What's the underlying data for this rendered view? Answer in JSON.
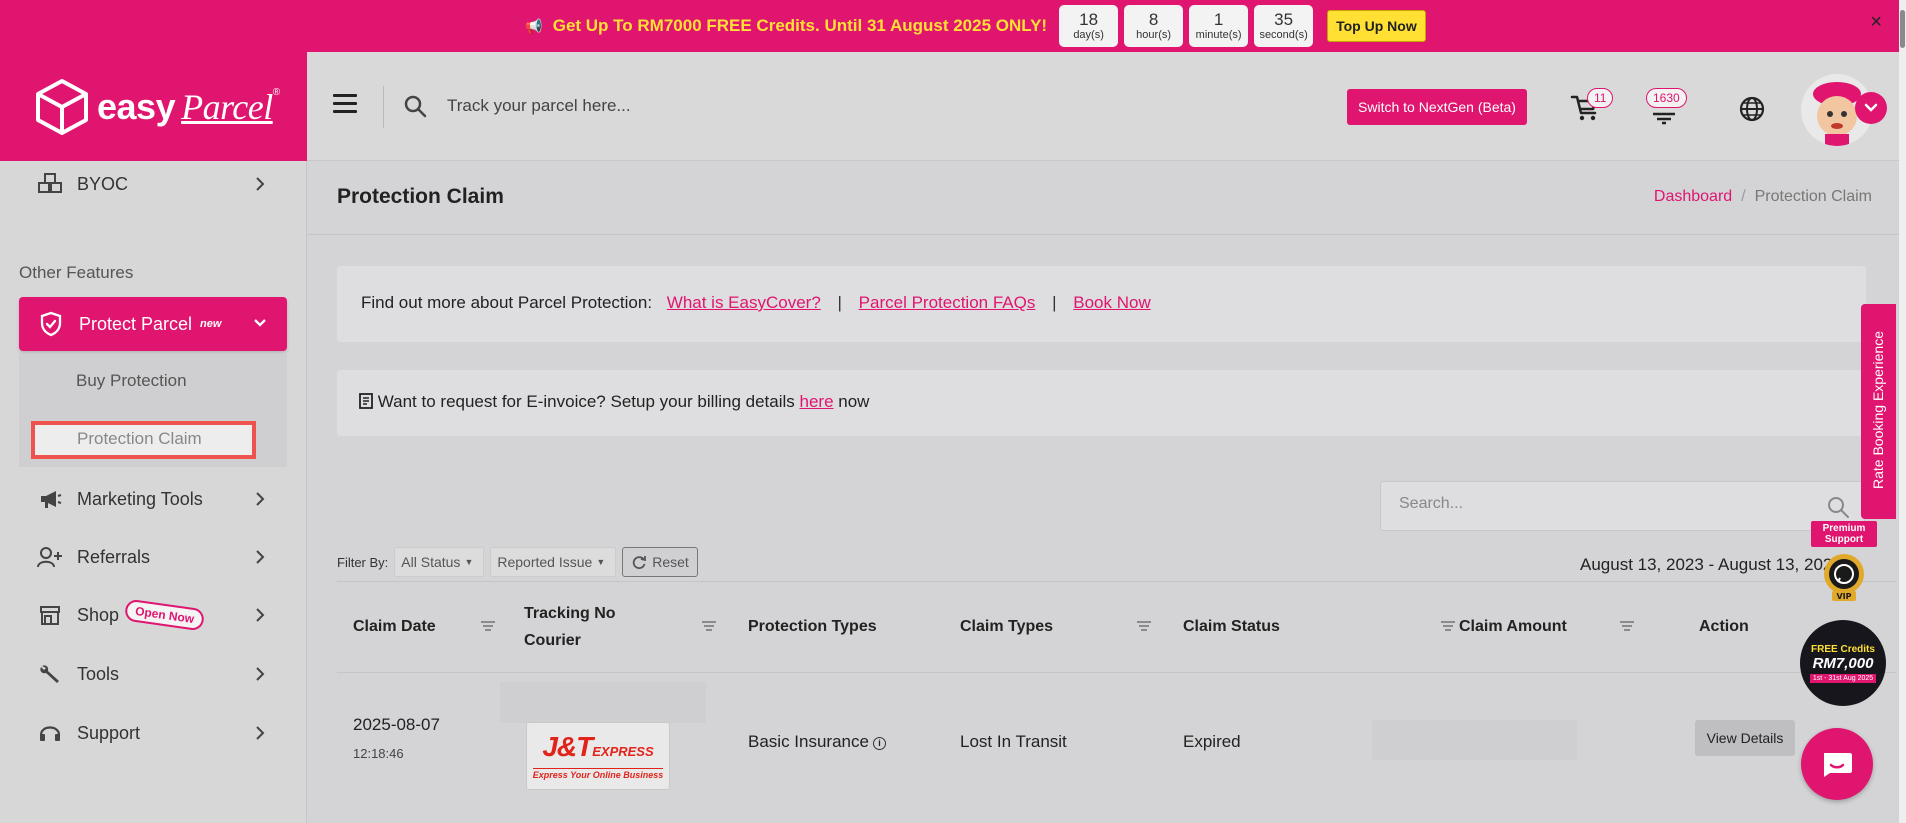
{
  "promo": {
    "text": "Get Up To RM7000 FREE Credits. Until 31 August 2025 ONLY!",
    "countdown": [
      {
        "value": "18",
        "unit": "day(s)"
      },
      {
        "value": "8",
        "unit": "hour(s)"
      },
      {
        "value": "1",
        "unit": "minute(s)"
      },
      {
        "value": "35",
        "unit": "second(s)"
      }
    ],
    "topup_label": "Top Up Now",
    "close": "×"
  },
  "brand": {
    "name": "easy",
    "name2": "Parcel",
    "reg": "®",
    "color": "#e0156f"
  },
  "header": {
    "search_placeholder": "Track your parcel here...",
    "nextgen_label": "Switch to NextGen (Beta)",
    "cart_count": "11",
    "notif_count": "1630"
  },
  "sidebar": {
    "byoc": "BYOC",
    "section": "Other Features",
    "protect": "Protect Parcel",
    "protect_tag": "new",
    "sub_buy": "Buy Protection",
    "sub_claim": "Protection Claim",
    "marketing": "Marketing Tools",
    "referrals": "Referrals",
    "shop": "Shop",
    "shop_tag": "Open Now",
    "tools": "Tools",
    "support": "Support"
  },
  "main": {
    "title": "Protection Claim",
    "breadcrumb": {
      "home": "Dashboard",
      "sep": "/",
      "current": "Protection Claim"
    },
    "info1": {
      "prefix": "Find out more about Parcel Protection:",
      "link1": "What is EasyCover?",
      "link2": "Parcel Protection FAQs",
      "link3": "Book Now",
      "sep": "|"
    },
    "info2": {
      "prefix": "Want to request for E-invoice? Setup your billing details",
      "link": "here",
      "suffix": "now"
    },
    "search_placeholder": "Search...",
    "filter": {
      "label": "Filter By:",
      "status": "All Status",
      "issue": "Reported Issue",
      "reset": "Reset"
    },
    "date_range": "August 13, 2023 - August 13, 2025"
  },
  "table": {
    "headers": {
      "claim_date": "Claim Date",
      "tracking_no": "Tracking No",
      "courier": "Courier",
      "protection_types": "Protection Types",
      "claim_types": "Claim Types",
      "claim_status": "Claim Status",
      "claim_amount": "Claim Amount",
      "action": "Action"
    },
    "rows": [
      {
        "date": "2025-08-07",
        "time": "12:18:46",
        "courier_logo": "J&T",
        "courier_logo_small": "EXPRESS",
        "courier_tagline": "Express Your Online Business",
        "protection_type": "Basic Insurance",
        "claim_type": "Lost In Transit",
        "status": "Expired",
        "action": "View Details"
      }
    ]
  },
  "widgets": {
    "rate": "Rate Booking Experience",
    "premium": "Premium Support",
    "vip": "VIP",
    "fc1": "FREE Credits",
    "fc2": "RM7,000",
    "fc3": "1st - 31st Aug 2025"
  }
}
